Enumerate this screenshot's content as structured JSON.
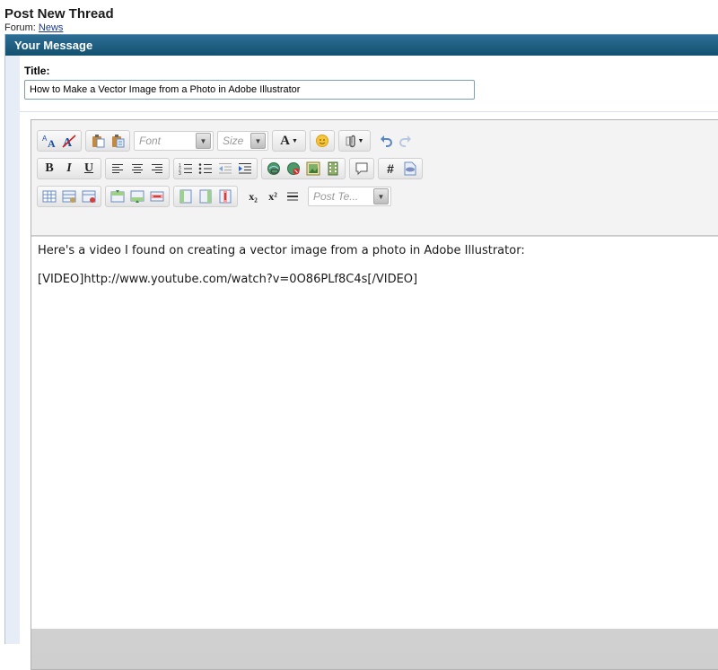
{
  "page": {
    "title": "Post New Thread",
    "forum_prefix": "Forum:",
    "forum_link": "News"
  },
  "section": {
    "header": "Your Message"
  },
  "form": {
    "title_label": "Title:",
    "title_value": "How to Make a Vector Image from a Photo in Adobe Illustrator"
  },
  "toolbar": {
    "font_placeholder": "Font",
    "size_placeholder": "Size",
    "post_template_placeholder": "Post Te...",
    "bold": "B",
    "italic": "I",
    "underline": "U",
    "hash": "#",
    "font_color": "A",
    "subscript": "x₂",
    "superscript": "x²"
  },
  "editor": {
    "line1": "Here's a video I found on creating a vector image from a photo in Adobe Illustrator:",
    "line2": "[VIDEO]http://www.youtube.com/watch?v=0O86PLf8C4s[/VIDEO]"
  },
  "colors": {
    "header_bar": "#13516f",
    "link": "#1a3a8a",
    "outer_bg": "#e6edf7"
  },
  "icons": [
    "switch-editor-mode-icon",
    "remove-formatting-icon",
    "paste-icon",
    "paste-as-text-icon",
    "font-color-icon",
    "smilie-icon",
    "attachment-icon",
    "undo-icon",
    "redo-icon",
    "align-left-icon",
    "align-center-icon",
    "align-right-icon",
    "ordered-list-icon",
    "unordered-list-icon",
    "outdent-icon",
    "indent-icon",
    "link-icon",
    "unlink-icon",
    "image-icon",
    "video-icon",
    "quote-icon",
    "php-icon",
    "table-icons"
  ]
}
